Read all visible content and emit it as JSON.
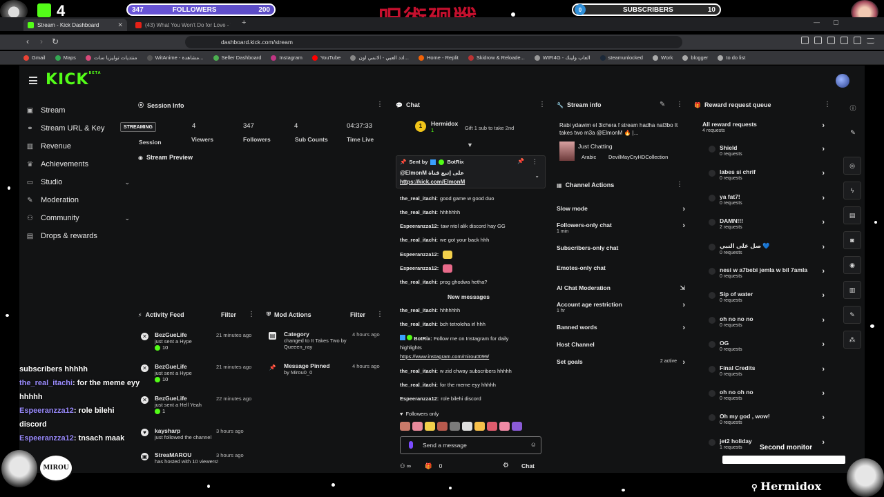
{
  "overlay": {
    "kick_count": "4",
    "followers_left": "347",
    "followers_label": "FOLLOWERS",
    "followers_right": "200",
    "subs_left": "0",
    "subs_label": "SUBSCRIBERS",
    "subs_right": "10",
    "title_art": "呪術廻戦",
    "streamer_tag": "Hermidox",
    "second_monitor": "Second monitor",
    "bottom_left_logo": "MIROU",
    "chat_messages": [
      {
        "user": "",
        "text": "subscribers hhhhh"
      },
      {
        "user": "the_real_itachi",
        "text": ": for the meme eyy hhhhh"
      },
      {
        "user": "Espeeranzza12",
        "text": ": role bilehi discord"
      },
      {
        "user": "Espeeranzza12",
        "text": ": tnsach maak"
      }
    ]
  },
  "browser": {
    "tabs": [
      {
        "title": "Stream - Kick Dashboard",
        "active": true
      },
      {
        "title": "(43) What You Won't Do for Love - Yo",
        "active": false
      }
    ],
    "url": "dashboard.kick.com/stream",
    "bookmarks": [
      "Gmail",
      "Maps",
      "منتديات توليزيا سات",
      "WitAnime - مشاهدة...",
      "Seller Dashboard",
      "Instagram",
      "YouTube",
      "ادد العبي - الانمي اون...",
      "Home - Replit",
      "Skidrow & Reloade...",
      "WIFI4G - العاب ولينك",
      "steamunlocked",
      "Work",
      "blogger",
      "to do list"
    ]
  },
  "dashboard": {
    "logo": "KICK",
    "logo_sup": "BETA",
    "nav": [
      {
        "label": "Stream",
        "icon": "video-icon",
        "chev": ""
      },
      {
        "label": "Stream URL & Key",
        "icon": "link-icon",
        "chev": ""
      },
      {
        "label": "Revenue",
        "icon": "chart-icon",
        "chev": ""
      },
      {
        "label": "Achievements",
        "icon": "trophy-icon",
        "chev": ""
      },
      {
        "label": "Studio",
        "icon": "camera-icon",
        "chev": "⌄"
      },
      {
        "label": "Moderation",
        "icon": "wrench-icon",
        "chev": ""
      },
      {
        "label": "Community",
        "icon": "people-icon",
        "chev": "⌄"
      },
      {
        "label": "Drops & rewards",
        "icon": "gift-icon",
        "chev": ""
      }
    ],
    "session": {
      "title": "Session Info",
      "badge": "STREAMING",
      "session_label": "Session",
      "viewers": "4",
      "viewers_label": "Viewers",
      "followers": "347",
      "followers_label": "Followers",
      "subs": "4",
      "subs_label": "Sub Counts",
      "time": "04:37:33",
      "time_label": "Time Live",
      "preview": "Stream Preview"
    },
    "activity": {
      "title": "Activity Feed",
      "filter": "Filter",
      "items": [
        {
          "who": "BezGueLife",
          "what": "just sent a Hype",
          "amt": "10",
          "time": "21 minutes ago"
        },
        {
          "who": "BezGueLife",
          "what": "just sent a Hype",
          "amt": "10",
          "time": "21 minutes ago"
        },
        {
          "who": "BezGueLife",
          "what": "just sent a Hell Yeah",
          "amt": "1",
          "time": "22 minutes ago"
        },
        {
          "who": "kaysharp",
          "what": "just followed the channel",
          "amt": "",
          "time": "3 hours ago"
        },
        {
          "who": "StreaMAROU",
          "what": "has hosted with 10 viewers!",
          "amt": "",
          "time": "3 hours ago"
        }
      ]
    },
    "mod_actions": {
      "title": "Mod Actions",
      "filter": "Filter",
      "items": [
        {
          "who": "Category",
          "what": "changed to It Takes Two by Queeen_ray",
          "time": "4 hours ago"
        },
        {
          "who": "Message Pinned",
          "what": "by Mirou0_0",
          "time": "4 hours ago"
        }
      ]
    },
    "chat": {
      "title": "Chat",
      "gifter": "Hermidox",
      "gifter_count": "1",
      "gift_text": "Gift 1 sub to take 2nd",
      "pinned_by": "Sent by",
      "pinned_user": "BotRix",
      "pinned_text": "@ElmonM على إتبع قناة",
      "pinned_link": "https://kick.com/ElmonM",
      "lines": [
        {
          "user": "the_real_itachi:",
          "text": "good game w good duo"
        },
        {
          "user": "the_real_itachi:",
          "text": "hhhhhhh"
        },
        {
          "user": "Espeeranzza12:",
          "text": "taw ntol alik discord hay GG"
        },
        {
          "user": "the_real_itachi:",
          "text": "we got your back hhh"
        },
        {
          "user": "Espeeranzza12:",
          "text": ""
        },
        {
          "user": "Espeeranzza12:",
          "text": ""
        },
        {
          "user": "the_real_itachi:",
          "text": "prog ghodwa hetha?"
        }
      ],
      "new_messages": "New messages",
      "lines2": [
        {
          "user": "the_real_itachi:",
          "text": "hhhhhhh"
        },
        {
          "user": "the_real_itachi:",
          "text": "bch tetroleha irl hhh"
        }
      ],
      "botrix_user": "BotRix:",
      "botrix_text": "Follow me on Instagram for daily",
      "botrix_text2": "highlights",
      "botrix_link": "https://www.instagram.com/mirou0099/",
      "lines3": [
        {
          "user": "the_real_itachi:",
          "text": "w zid chway subscribers hhhhh"
        },
        {
          "user": "the_real_itachi:",
          "text": "for the meme eyy hhhhh"
        },
        {
          "user": "Espeeranzza12:",
          "text": "role bilehi discord"
        }
      ],
      "followers_only": "Followers only",
      "placeholder": "Send a message",
      "footer_count": "0",
      "send_label": "Chat"
    },
    "stream_info": {
      "title": "Stream info",
      "stream_title": "Rabi ydawim el 3ichera f stream hadha nal3bo It takes two m3a @ElmonM 🔥 |...",
      "category": "Just Chatting",
      "language": "Arabic",
      "tag": "DevilMayCryHDCollection"
    },
    "channel_actions": {
      "title": "Channel Actions",
      "items": [
        {
          "label": "Slow mode",
          "sub": "",
          "tag": ""
        },
        {
          "label": "Followers-only chat",
          "sub": "1 min",
          "tag": ""
        },
        {
          "label": "Subscribers-only chat",
          "sub": "",
          "tag": ""
        },
        {
          "label": "Emotes-only chat",
          "sub": "",
          "tag": ""
        },
        {
          "label": "AI Chat Moderation",
          "sub": "",
          "tag": ""
        },
        {
          "label": "Account age restriction",
          "sub": "1 hr",
          "tag": ""
        },
        {
          "label": "Banned words",
          "sub": "",
          "tag": ""
        },
        {
          "label": "Host Channel",
          "sub": "",
          "tag": ""
        },
        {
          "label": "Set goals",
          "sub": "",
          "tag": "2 active"
        }
      ]
    },
    "rewards": {
      "title": "Reward request queue",
      "all_label": "All reward requests",
      "all_count": "4 requests",
      "items": [
        {
          "name": "Shield",
          "count": "0 requests"
        },
        {
          "name": "labes si chrif",
          "count": "0 requests"
        },
        {
          "name": "ya fat7!",
          "count": "0 requests"
        },
        {
          "name": "DAMN!!!",
          "count": "2 requests"
        },
        {
          "name": "صل على النبي 💙",
          "count": "0 requests"
        },
        {
          "name": "nesi w a7bebi jemla w bil 7amla",
          "count": "0 requests"
        },
        {
          "name": "Sip of water",
          "count": "0 requests"
        },
        {
          "name": "oh no no no",
          "count": "0 requests"
        },
        {
          "name": "OG",
          "count": "0 requests"
        },
        {
          "name": "Final Credits",
          "count": "0 requests"
        },
        {
          "name": "oh no oh no",
          "count": "0 requests"
        },
        {
          "name": "Oh my god , wow!",
          "count": "0 requests"
        },
        {
          "name": "jet2 holiday",
          "count": "1 requests"
        }
      ]
    }
  }
}
